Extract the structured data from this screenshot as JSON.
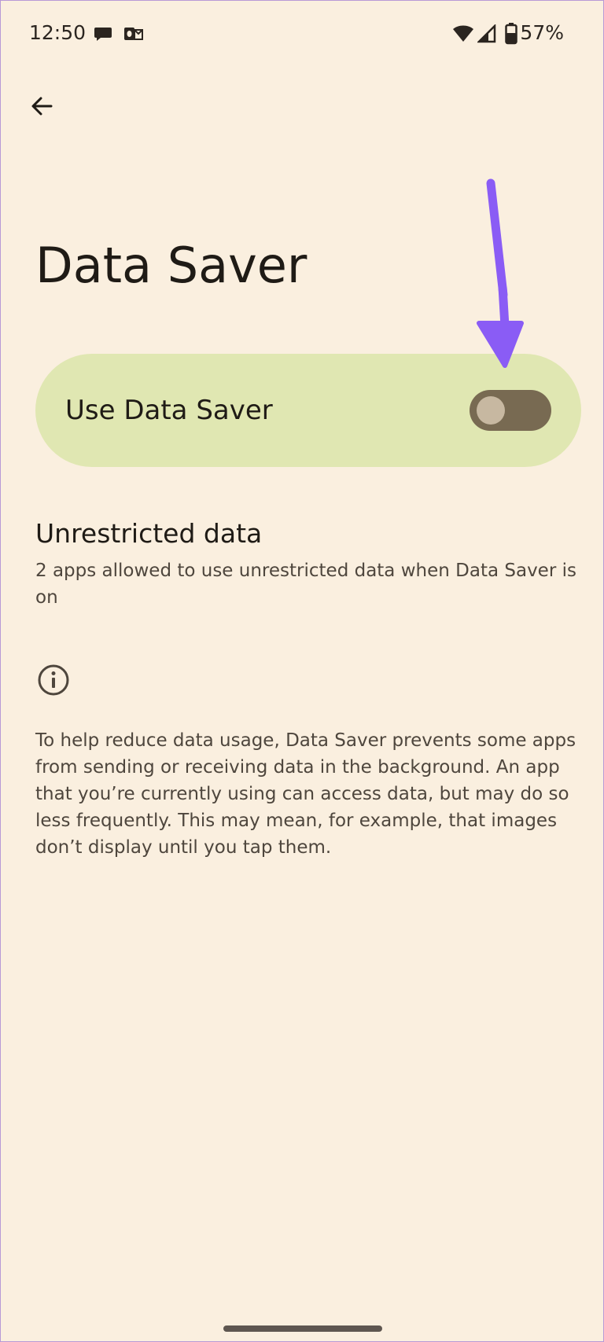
{
  "status_bar": {
    "time": "12:50",
    "battery": "57%"
  },
  "page": {
    "title": "Data Saver"
  },
  "main_switch": {
    "label": "Use Data Saver",
    "checked": false
  },
  "unrestricted": {
    "title": "Unrestricted data",
    "summary": "2 apps allowed to use unrestricted data when Data Saver is on"
  },
  "footer": {
    "text": "To help reduce data usage, Data Saver prevents some apps from sending or receiving data in the background. An app that you’re currently using can access data, but may do so less frequently. This may mean, for example, that images don’t display until you tap them."
  },
  "icons": {
    "back": "arrow-back-icon",
    "info": "info-icon",
    "messages": "chat-bubble-icon",
    "outlook": "outlook-icon",
    "wifi": "wifi-icon",
    "signal": "cell-signal-icon",
    "battery": "battery-icon"
  },
  "colors": {
    "background": "#faefdf",
    "switch_card": "#e0e7b2",
    "toggle_track_off": "#786a52",
    "toggle_thumb_off": "#c7b8a1",
    "annotation_arrow": "#8a5cf5"
  }
}
